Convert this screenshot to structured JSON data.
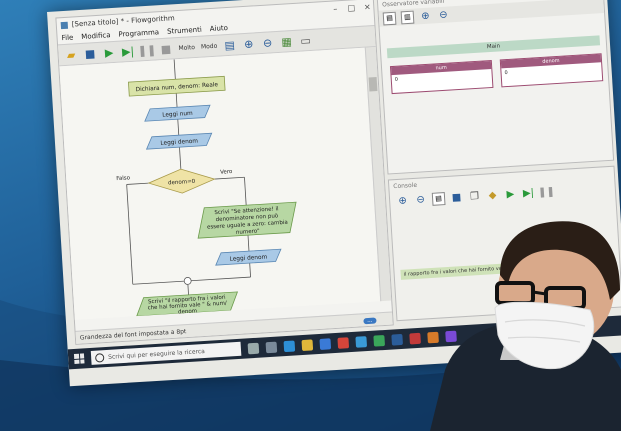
{
  "main_window": {
    "title": "[Senza titolo] * - Flowgorithm",
    "menu": [
      "File",
      "Modifica",
      "Programma",
      "Strumenti",
      "Aiuto"
    ],
    "toolbar_labels": {
      "speed": "Molto",
      "mode": "Modo"
    },
    "status_text": "Grandezza del font impostata a 8pt",
    "zoom_badge": "..."
  },
  "flowchart": {
    "declare": "Dichiara num, denom: Reale",
    "read_num": "Leggi num",
    "read_denom": "Leggi denom",
    "loop_condition": "denom=0",
    "false_label": "Falso",
    "true_label": "Vero",
    "output_warning": [
      "Scrivi \"Se attenzione! il",
      "denominatore non può",
      "essere uguale a zero: cambia",
      "numero\""
    ],
    "read_denom_again": "Leggi denom",
    "output_result": [
      "Scrivi \"il rapporto fra i valori",
      "che hai fornito vale \" & num/",
      "denom"
    ]
  },
  "variables_window": {
    "title": "Osservatore variabili",
    "main_label": "Main",
    "vars": [
      {
        "name": "num",
        "value": "0"
      },
      {
        "name": "denom",
        "value": "0"
      }
    ]
  },
  "console_window": {
    "title": "Console",
    "output": "il rapporto fra i valori che hai fornito vale 0.625"
  },
  "taskbar": {
    "search_placeholder": "Scrivi qui per eseguire la ricerca"
  },
  "colors": {
    "process_fill": "#d9e3a8",
    "io_fill": "#a9c9e6",
    "output_fill": "#b7d7a3",
    "decision_fill": "#efe3a6",
    "var_header": "#a05a7e"
  }
}
